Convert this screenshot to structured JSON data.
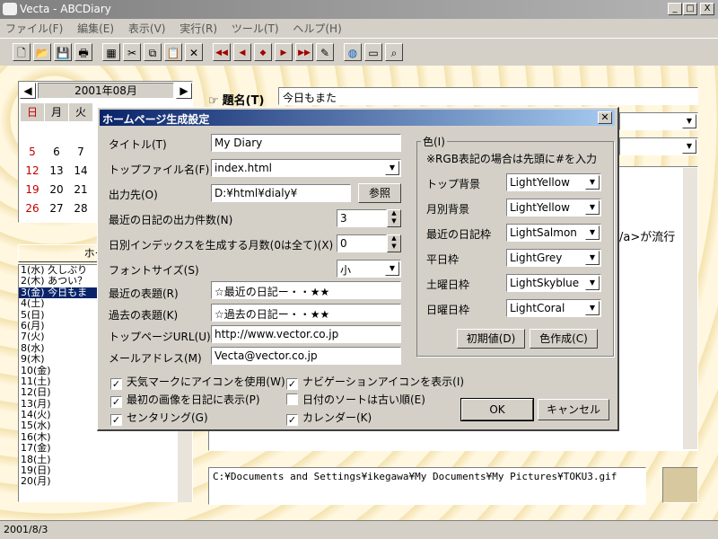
{
  "window": {
    "title": "Vecta - ABCDiary",
    "min": "_",
    "max": "□",
    "close": "X"
  },
  "menu": [
    "ファイル(F)",
    "編集(E)",
    "表示(V)",
    "実行(R)",
    "ツール(T)",
    "ヘルプ(H)"
  ],
  "toolbar": {
    "new": "🗋",
    "open": "📂",
    "save": "💾",
    "print": "🖶",
    "image": "▦",
    "cut": "✂",
    "copy": "⧉",
    "paste": "📋",
    "delete": "✕",
    "first": "◀◀",
    "prev": "◀",
    "mid": "◆",
    "next": "▶",
    "last": "▶▶",
    "edit": "✎",
    "web": "◍",
    "card": "▭",
    "find": "⌕"
  },
  "calendar": {
    "month": "2001年08月",
    "prev": "◀",
    "next": "▶",
    "headers": [
      "日",
      "月",
      "火"
    ],
    "rows": [
      [
        "5",
        "6",
        "7"
      ],
      [
        "12",
        "13",
        "14"
      ],
      [
        "19",
        "20",
        "21"
      ],
      [
        "26",
        "27",
        "28"
      ]
    ]
  },
  "left": {
    "homepage_label": "ホームペ",
    "entries": [
      "1(水) 久しぶり",
      "2(木) あつい？",
      "3(金) 今日もま",
      "4(土)",
      "5(日)",
      "6(月)",
      "7(火)",
      "8(水)",
      "9(木)",
      "10(金)",
      "11(土)",
      "12(日)",
      "13(月)",
      "14(火)",
      "15(水)",
      "16(木)",
      "17(金)",
      "18(土)",
      "19(日)",
      "20(月)"
    ],
    "selected_index": 2
  },
  "right": {
    "subject_label": "題名(T)",
    "subject_value": "今日もまた",
    "editor_visible_text": "/a>が流行",
    "path": "C:¥Documents and Settings¥ikegawa¥My Documents¥My Pictures¥TOKU3.gif"
  },
  "status": {
    "date": "2001/8/3"
  },
  "dialog": {
    "title": "ホームページ生成設定",
    "close": "✕",
    "title_label": "タイトル(T)",
    "title_value": "My Diary",
    "topfile_label": "トップファイル名(F)",
    "topfile_value": "index.html",
    "output_label": "出力先(O)",
    "output_value": "D:¥html¥dialy¥",
    "browse": "参照",
    "recent_count_label": "最近の日記の出力件数(N)",
    "recent_count_value": "3",
    "months_label": "日別インデックスを生成する月数(0は全て)(X)",
    "months_value": "0",
    "font_label": "フォントサイズ(S)",
    "font_value": "小",
    "recent_title_label": "最近の表題(R)",
    "recent_title_value": "☆最近の日記ー・・★★",
    "past_title_label": "過去の表題(K)",
    "past_title_value": "☆過去の日記ー・・★★",
    "top_url_label": "トップページURL(U)",
    "top_url_value": "http://www.vector.co.jp",
    "mail_label": "メールアドレス(M)",
    "mail_value": "Vecta@vector.co.jp",
    "checks": [
      {
        "label": "天気マークにアイコンを使用(W)",
        "checked": true
      },
      {
        "label": "最初の画像を日記に表示(P)",
        "checked": true
      },
      {
        "label": "センタリング(G)",
        "checked": true
      },
      {
        "label": "ナビゲーションアイコンを表示(I)",
        "checked": true
      },
      {
        "label": "日付のソートは古い順(E)",
        "checked": false
      },
      {
        "label": "カレンダー(K)",
        "checked": true
      }
    ],
    "color_group": "色(I)",
    "color_note": "※RGB表記の場合は先頭に#を入力",
    "colors": [
      {
        "label": "トップ背景",
        "value": "LightYellow"
      },
      {
        "label": "月別背景",
        "value": "LightYellow"
      },
      {
        "label": "最近の日記枠",
        "value": "LightSalmon"
      },
      {
        "label": "平日枠",
        "value": "LightGrey"
      },
      {
        "label": "土曜日枠",
        "value": "LightSkyblue"
      },
      {
        "label": "日曜日枠",
        "value": "LightCoral"
      }
    ],
    "init_button": "初期値(D)",
    "make_color_button": "色作成(C)",
    "ok": "OK",
    "cancel": "キャンセル"
  }
}
